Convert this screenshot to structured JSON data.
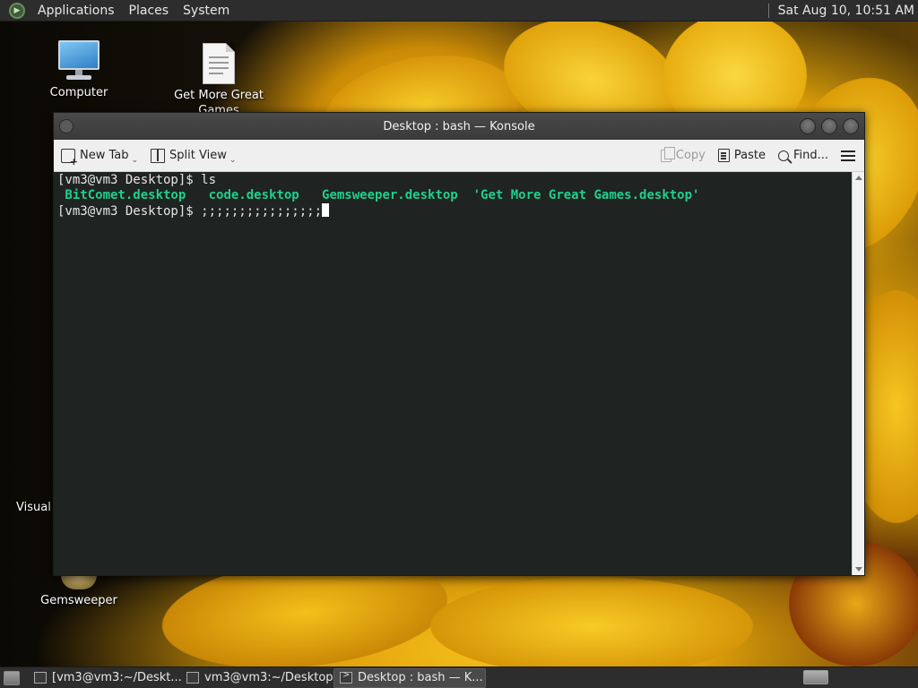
{
  "top_panel": {
    "menu": [
      "Applications",
      "Places",
      "System"
    ],
    "clock": "Sat Aug 10, 10:51 AM"
  },
  "desktop_icons": {
    "computer": "Computer",
    "get_more_games_line1": "Get More Great",
    "get_more_games_line2": "Games",
    "vs_code": "Visual S",
    "gemsweeper": "Gemsweeper"
  },
  "window": {
    "title": "Desktop : bash — Konsole",
    "toolbar": {
      "new_tab": "New Tab",
      "split_view": "Split View",
      "copy": "Copy",
      "paste": "Paste",
      "find": "Find..."
    },
    "terminal": {
      "line1_prompt": "[vm3@vm3 Desktop]$ ",
      "line1_cmd": "ls",
      "ls_output": [
        " BitComet.desktop",
        "   code.desktop",
        "   Gemsweeper.desktop",
        "  'Get More Great Games.desktop'"
      ],
      "line3_prompt": "[vm3@vm3 Desktop]$ ",
      "line3_input": ";;;;;;;;;;;;;;;;"
    }
  },
  "taskbar": {
    "tasks": [
      "[vm3@vm3:~/Deskt...",
      "vm3@vm3:~/Desktop",
      "Desktop : bash — K..."
    ],
    "active_index": 2
  },
  "colors": {
    "panel": "#2d2d2d",
    "terminal_bg": "#1f2322",
    "terminal_green": "#1fd08a",
    "toolbar_bg": "#efefef"
  }
}
